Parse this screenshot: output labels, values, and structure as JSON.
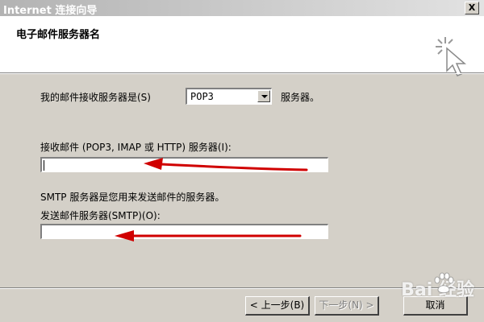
{
  "window": {
    "title": "Internet 连接向导",
    "close_label": "X"
  },
  "header": {
    "title": "电子邮件服务器名"
  },
  "incoming": {
    "prefix_label": "我的邮件接收服务器是(S)",
    "server_type": "POP3",
    "suffix_label": "服务器。",
    "server_label": "接收邮件 (POP3, IMAP 或 HTTP) 服务器(I):",
    "server_value": ""
  },
  "outgoing": {
    "info_text": "SMTP 服务器是您用来发送邮件的服务器。",
    "server_label": "发送邮件服务器(SMTP)(O):",
    "server_value": ""
  },
  "buttons": {
    "back": "< 上一步(B)",
    "next": "下一步(N) >",
    "cancel": "取消"
  },
  "watermark": "Bai  经验",
  "colors": {
    "annotation_arrow": "#d00000",
    "dialog_bg": "#d4d0c8"
  }
}
